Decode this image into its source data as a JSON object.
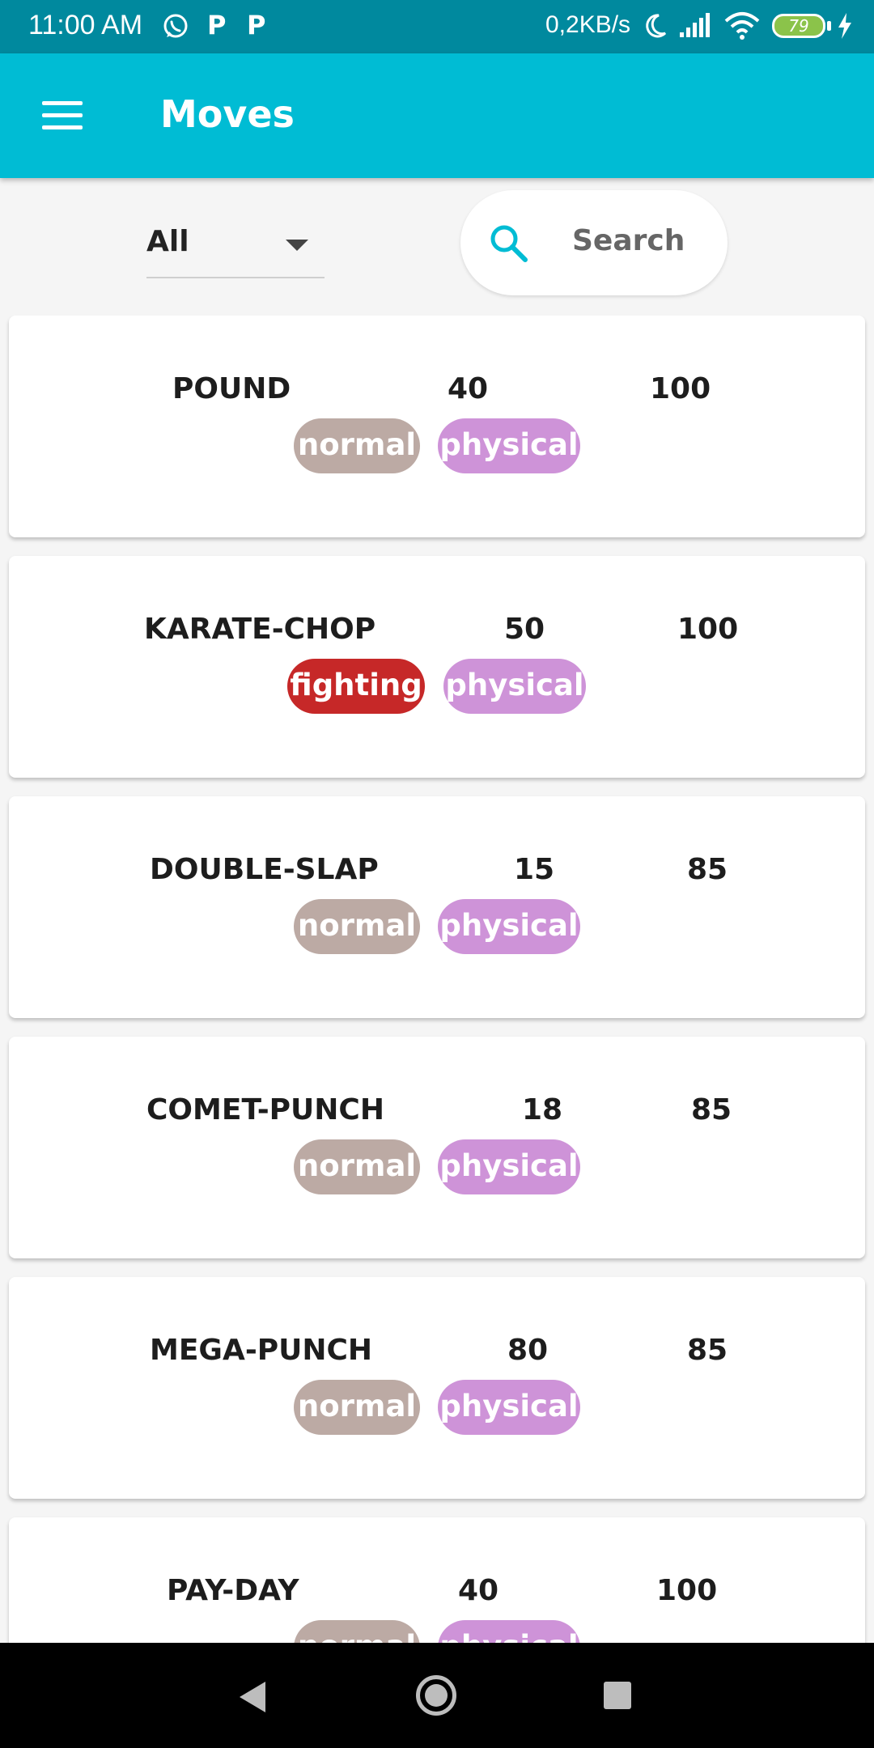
{
  "status_bar": {
    "time": "11:00 AM",
    "speed": "0,2KB/s",
    "battery": "79",
    "icons": [
      "whatsapp-icon",
      "p-app-icon",
      "p-app-icon",
      "moon-icon",
      "signal-icon",
      "wifi-icon",
      "battery-icon",
      "charging-icon"
    ]
  },
  "app_bar": {
    "title": "Moves",
    "menu_icon": "hamburger-menu-icon"
  },
  "filter": {
    "selected": "All",
    "search_label": "Search"
  },
  "moves": [
    {
      "name": "POUND",
      "power": "40",
      "accuracy": "100",
      "type": "normal",
      "category": "physical"
    },
    {
      "name": "KARATE-CHOP",
      "power": "50",
      "accuracy": "100",
      "type": "fighting",
      "category": "physical"
    },
    {
      "name": "DOUBLE-SLAP",
      "power": "15",
      "accuracy": "85",
      "type": "normal",
      "category": "physical"
    },
    {
      "name": "COMET-PUNCH",
      "power": "18",
      "accuracy": "85",
      "type": "normal",
      "category": "physical"
    },
    {
      "name": "MEGA-PUNCH",
      "power": "80",
      "accuracy": "85",
      "type": "normal",
      "category": "physical"
    },
    {
      "name": "PAY-DAY",
      "power": "40",
      "accuracy": "100",
      "type": "normal",
      "category": "physical"
    }
  ],
  "colors": {
    "status_bar": "#00899e",
    "app_bar": "#00bcd4",
    "type_normal": "#bcaaa4",
    "type_fighting": "#c62828",
    "category_physical": "#ce93d8"
  }
}
